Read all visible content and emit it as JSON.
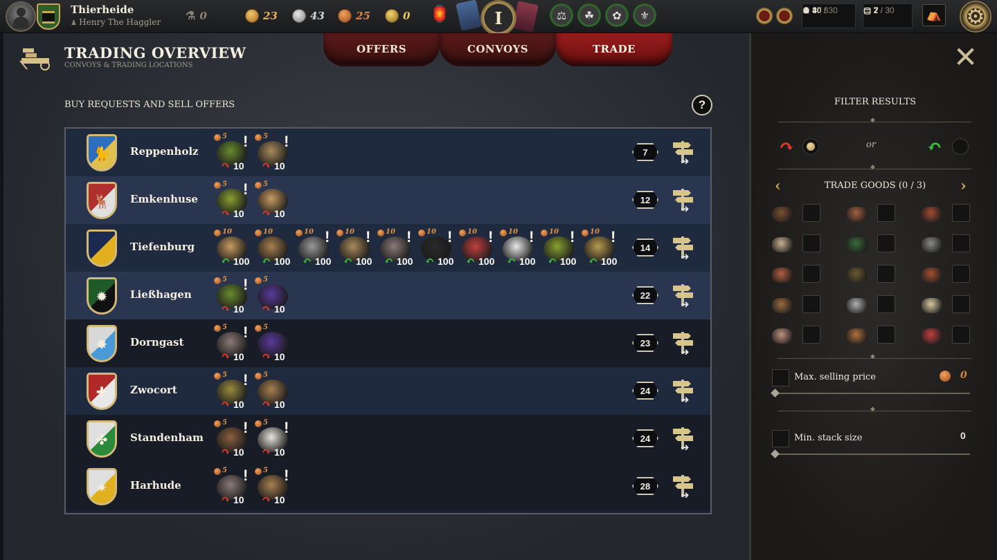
{
  "header": {
    "town_name": "Thierheide",
    "player_name": "Henry The Haggler",
    "research_value": "0",
    "resources": [
      {
        "icon": "gold-coin-icon",
        "value": "23",
        "color": "#e8b24f"
      },
      {
        "icon": "silver-coin-icon",
        "value": "43",
        "color": "#d6d6d6"
      },
      {
        "icon": "copper-coin-icon",
        "value": "25",
        "color": "#e0883e"
      },
      {
        "icon": "crown-icon",
        "value": "0",
        "color": "#e8c557"
      }
    ],
    "hub_label": "I",
    "population_current": "30",
    "population_max": "/ 30",
    "workers_current": "4",
    "workers_max": "/ 8",
    "storage_current": "7",
    "storage_max": "/ 30",
    "convoys_current": "2",
    "convoys_max": "/ 3"
  },
  "page": {
    "title": "TRADING OVERVIEW",
    "subtitle": "CONVOYS & TRADING LOCATIONS",
    "tabs": [
      "OFFERS",
      "CONVOYS",
      "TRADE"
    ],
    "active_tab": "TRADE",
    "section_label": "BUY REQUESTS AND SELL OFFERS",
    "help": "?"
  },
  "towns": [
    {
      "name": "Reppenholz",
      "distance": "7",
      "shield": [
        "#2c6fc0",
        "#e0c04a"
      ],
      "emblem": "🐈",
      "goods": [
        {
          "price": "5",
          "type": "sell",
          "qty": "10",
          "item": "vegetables",
          "color": "#6a8a30",
          "alert": "!"
        },
        {
          "price": "5",
          "type": "sell",
          "qty": "10",
          "item": "ore",
          "color": "#a88a5a",
          "alert": "!"
        }
      ]
    },
    {
      "name": "Emkenhuse",
      "distance": "12",
      "shield": [
        "#b03030",
        "#e0e0e0"
      ],
      "emblem": "🦌",
      "goods": [
        {
          "price": "5",
          "type": "sell",
          "qty": "10",
          "item": "corn",
          "color": "#8aa030",
          "alert": "!"
        },
        {
          "price": "5",
          "type": "sell",
          "qty": "10",
          "item": "sand",
          "color": "#c79a60",
          "alert": ""
        }
      ]
    },
    {
      "name": "Tiefenburg",
      "distance": "14",
      "shield": [
        "#1a2a50",
        "#e0b020"
      ],
      "emblem": "",
      "goods": [
        {
          "price": "10",
          "type": "buy",
          "qty": "100",
          "item": "sand",
          "color": "#c79a60",
          "alert": ""
        },
        {
          "price": "10",
          "type": "buy",
          "qty": "100",
          "item": "logs",
          "color": "#a88050",
          "alert": ""
        },
        {
          "price": "10",
          "type": "buy",
          "qty": "100",
          "item": "stone",
          "color": "#9a9a9a",
          "alert": "!"
        },
        {
          "price": "10",
          "type": "buy",
          "qty": "100",
          "item": "ore",
          "color": "#a88a5a",
          "alert": "!"
        },
        {
          "price": "10",
          "type": "buy",
          "qty": "100",
          "item": "iron-ore",
          "color": "#8a7a78",
          "alert": "!"
        },
        {
          "price": "10",
          "type": "buy",
          "qty": "100",
          "item": "coal",
          "color": "#2a2a2a",
          "alert": "!"
        },
        {
          "price": "10",
          "type": "buy",
          "qty": "100",
          "item": "meat",
          "color": "#c04040",
          "alert": "!"
        },
        {
          "price": "10",
          "type": "buy",
          "qty": "100",
          "item": "salt",
          "color": "#e8e8e8",
          "alert": "!"
        },
        {
          "price": "10",
          "type": "buy",
          "qty": "100",
          "item": "corn",
          "color": "#8aa030",
          "alert": "!"
        },
        {
          "price": "10",
          "type": "buy",
          "qty": "100",
          "item": "wheat",
          "color": "#b89a50",
          "alert": "!"
        }
      ]
    },
    {
      "name": "Lie&#223;hagen",
      "distance": "22",
      "shield": [
        "#1f5a2a",
        "#111111"
      ],
      "emblem": "✹",
      "goods": [
        {
          "price": "5",
          "type": "sell",
          "qty": "10",
          "item": "vegetables",
          "color": "#6a8a30",
          "alert": "!"
        },
        {
          "price": "5",
          "type": "sell",
          "qty": "10",
          "item": "berries",
          "color": "#5a3a9a",
          "alert": ""
        }
      ]
    },
    {
      "name": "Dorngast",
      "distance": "23",
      "shield": [
        "#d8d8d8",
        "#4a9ad8"
      ],
      "emblem": "✸",
      "goods": [
        {
          "price": "5",
          "type": "sell",
          "qty": "10",
          "item": "iron-ore",
          "color": "#8a7a78",
          "alert": "!"
        },
        {
          "price": "5",
          "type": "sell",
          "qty": "10",
          "item": "berries",
          "color": "#5a3a9a",
          "alert": ""
        }
      ]
    },
    {
      "name": "Zwocort",
      "distance": "24",
      "shield": [
        "#b02828",
        "#e8e8e8"
      ],
      "emblem": "✚",
      "goods": [
        {
          "price": "5",
          "type": "sell",
          "qty": "10",
          "item": "wheat",
          "color": "#9a8a40",
          "alert": "!"
        },
        {
          "price": "5",
          "type": "sell",
          "qty": "10",
          "item": "logs",
          "color": "#a88050",
          "alert": ""
        }
      ]
    },
    {
      "name": "Standenham",
      "distance": "24",
      "shield": [
        "#e0e0e0",
        "#2a8a3a"
      ],
      "emblem": "✤",
      "goods": [
        {
          "price": "5",
          "type": "sell",
          "qty": "10",
          "item": "hides",
          "color": "#8a6040",
          "alert": "!"
        },
        {
          "price": "5",
          "type": "sell",
          "qty": "10",
          "item": "wool",
          "color": "#e8e4dc",
          "alert": "!"
        }
      ]
    },
    {
      "name": "Harhude",
      "distance": "28",
      "shield": [
        "#e0e0e0",
        "#e0b020"
      ],
      "emblem": "✷",
      "goods": [
        {
          "price": "5",
          "type": "sell",
          "qty": "10",
          "item": "iron-ore",
          "color": "#8a7a78",
          "alert": "!"
        },
        {
          "price": "5",
          "type": "sell",
          "qty": "10",
          "item": "logs",
          "color": "#a88050",
          "alert": "!"
        }
      ]
    }
  ],
  "filter": {
    "title": "FILTER RESULTS",
    "or_label": "or",
    "trade_goods_label": "TRADE GOODS (0 / 3)",
    "goods": [
      {
        "name": "barrel",
        "color": "#7a5030"
      },
      {
        "name": "beer-mug",
        "color": "#a06040"
      },
      {
        "name": "jug",
        "color": "#a04a30"
      },
      {
        "name": "flour-sack",
        "color": "#c8b090"
      },
      {
        "name": "wine-bottles",
        "color": "#3a6a3a"
      },
      {
        "name": "iron-bar",
        "color": "#8a8a8a"
      },
      {
        "name": "ham",
        "color": "#b06040"
      },
      {
        "name": "fish",
        "color": "#6a5a30"
      },
      {
        "name": "provisions",
        "color": "#a05030"
      },
      {
        "name": "spices",
        "color": "#9a6a40"
      },
      {
        "name": "cloth",
        "color": "#b0b0b0"
      },
      {
        "name": "parchment",
        "color": "#d8c8a0"
      },
      {
        "name": "planks",
        "color": "#c09080"
      },
      {
        "name": "bread",
        "color": "#b07040"
      },
      {
        "name": "gems",
        "color": "#c04040"
      }
    ],
    "max_price_label": "Max. selling price",
    "max_price_value": "0",
    "min_stack_label": "Min. stack size",
    "min_stack_value": "0",
    "sell_color": "#e23b2b",
    "buy_color": "#39c03a"
  }
}
